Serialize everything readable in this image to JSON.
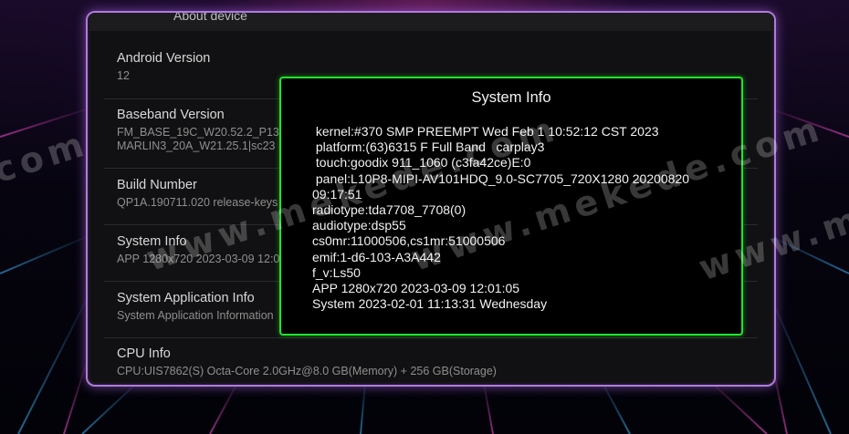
{
  "panel": {
    "header": "About device",
    "items": [
      {
        "title": "Android Version",
        "subtitle": "12"
      },
      {
        "title": "Baseband Version",
        "subtitle": "FM_BASE_19C_W20.52.2_P13|",
        "subtitle2": "MARLIN3_20A_W21.25.1|sc23"
      },
      {
        "title": "Build Number",
        "subtitle": "QP1A.190711.020 release-keys"
      },
      {
        "title": "System Info",
        "subtitle": "APP 1280x720 2023-03-09 12:0"
      },
      {
        "title": "System Application Info",
        "subtitle": "System Application Information"
      },
      {
        "title": "CPU Info",
        "subtitle": "CPU:UIS7862(S) Octa-Core 2.0GHz@8.0 GB(Memory) + 256 GB(Storage)"
      }
    ]
  },
  "dialog": {
    "title": "System Info",
    "lines": [
      " kernel:#370 SMP PREEMPT Wed Feb 1 10:52:12 CST 2023",
      " platform:(63)6315 F Full Band   carplay3",
      " touch:goodix 911_1060 (c3fa42ce)E:0",
      " panel:L10P8-MIPI-AV101HDQ_9.0-SC7705_720X1280 20200820 09:17:51",
      "radiotype:tda7708_7708(0)",
      "audiotype:dsp55",
      "cs0mr:11000506,cs1mr:51000506",
      "emif:1-d6-103-A3A442",
      "f_v:Ls50",
      "APP 1280x720 2023-03-09 12:01:05",
      "System 2023-02-01 11:13:31 Wednesday"
    ]
  },
  "watermark": {
    "text_left": "com",
    "text_center": "www.mekede.com",
    "text_right": "www.meke"
  },
  "colors": {
    "dialog_border": "#1de629",
    "panel_border": "#b07ae0"
  }
}
